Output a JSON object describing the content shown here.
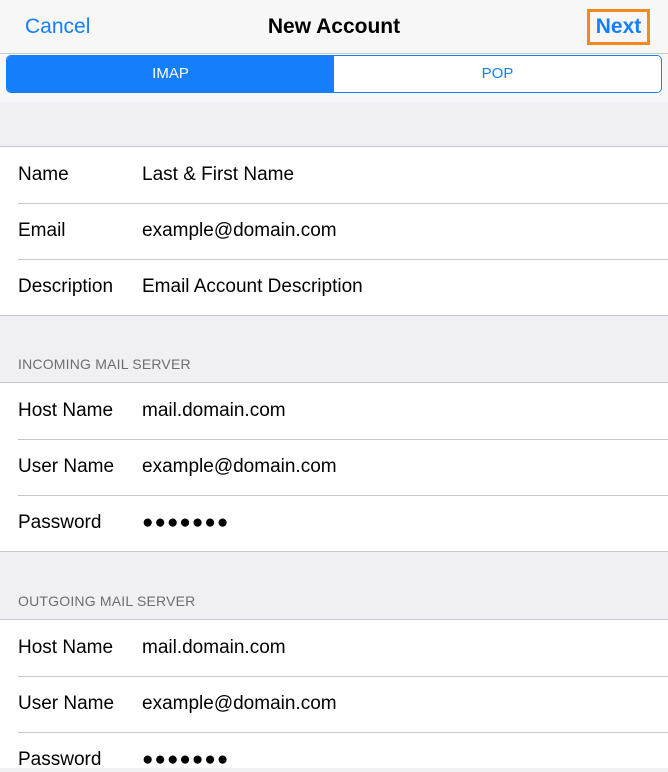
{
  "navbar": {
    "cancel_label": "Cancel",
    "title": "New Account",
    "next_label": "Next"
  },
  "segmented": {
    "options": [
      "IMAP",
      "POP"
    ],
    "selected": "IMAP"
  },
  "account": {
    "name_label": "Name",
    "name_value": "Last & First Name",
    "email_label": "Email",
    "email_value": "example@domain.com",
    "description_label": "Description",
    "description_value": "Email Account Description"
  },
  "incoming": {
    "header": "INCOMING MAIL SERVER",
    "host_label": "Host Name",
    "host_value": "mail.domain.com",
    "user_label": "User Name",
    "user_value": "example@domain.com",
    "password_label": "Password",
    "password_value": "●●●●●●●"
  },
  "outgoing": {
    "header": "OUTGOING MAIL SERVER",
    "host_label": "Host Name",
    "host_value": "mail.domain.com",
    "user_label": "User Name",
    "user_value": "example@domain.com",
    "password_label": "Password",
    "password_value": "●●●●●●●"
  },
  "colors": {
    "accent": "#147efb",
    "highlight": "#f28a1e",
    "background": "#efeff4",
    "separator": "#c8c7cc",
    "section_header": "#6d6d72"
  }
}
